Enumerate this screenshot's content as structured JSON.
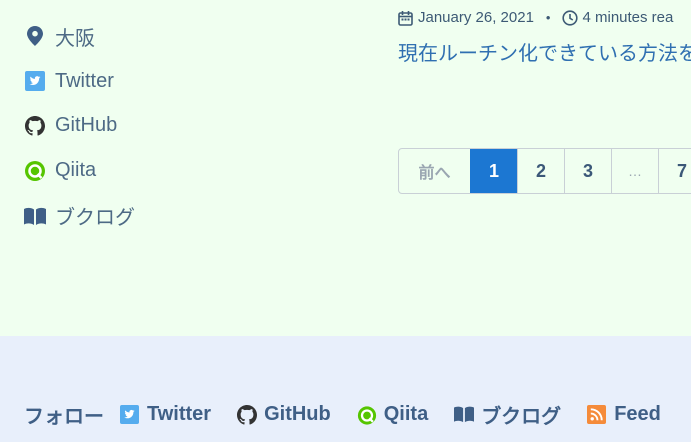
{
  "sidebar": {
    "items": [
      {
        "label": "大阪",
        "icon": "location-pin-icon"
      },
      {
        "label": "Twitter",
        "icon": "twitter-icon"
      },
      {
        "label": "GitHub",
        "icon": "github-icon"
      },
      {
        "label": "Qiita",
        "icon": "qiita-icon"
      },
      {
        "label": "ブクログ",
        "icon": "book-icon"
      }
    ]
  },
  "post": {
    "date": "January 26, 2021",
    "separator": "•",
    "read_time": "4 minutes rea",
    "title": "現在ルーチン化できている方法を"
  },
  "pagination": {
    "prev_label": "前へ",
    "pages": [
      "1",
      "2",
      "3"
    ],
    "ellipsis": "…",
    "last_page": "7",
    "current_page": "1"
  },
  "footer": {
    "follow_label": "フォロー",
    "links": [
      {
        "label": "Twitter",
        "icon": "twitter-icon"
      },
      {
        "label": "GitHub",
        "icon": "github-icon"
      },
      {
        "label": "Qiita",
        "icon": "qiita-icon"
      },
      {
        "label": "ブクログ",
        "icon": "book-icon"
      },
      {
        "label": "Feed",
        "icon": "rss-feed-icon"
      }
    ]
  },
  "colors": {
    "background": "#f0fff0",
    "footer_background": "#e8effb",
    "accent": "#1c77d2",
    "twitter": "#55acee",
    "qiita": "#55c500",
    "rss": "#f58b3a"
  }
}
